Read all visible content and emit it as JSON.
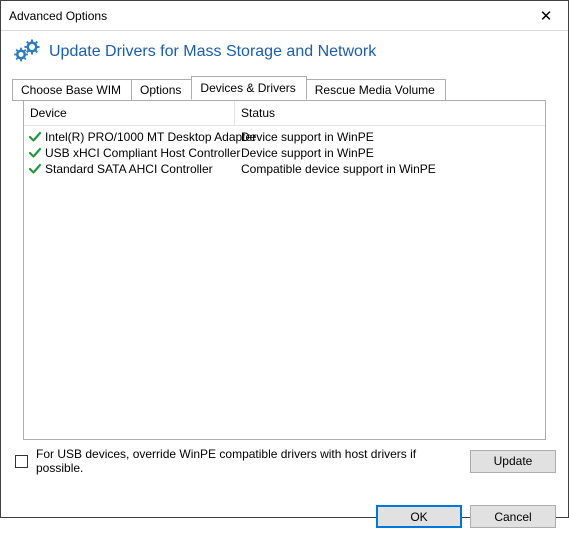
{
  "window": {
    "title": "Advanced Options",
    "close_glyph": "✕"
  },
  "header": {
    "title": "Update Drivers for Mass Storage and Network"
  },
  "tabs": {
    "items": [
      {
        "label": "Choose Base WIM"
      },
      {
        "label": "Options"
      },
      {
        "label": "Devices & Drivers"
      },
      {
        "label": "Rescue Media Volume"
      }
    ],
    "active_index": 2
  },
  "table": {
    "columns": {
      "device": "Device",
      "status": "Status"
    },
    "rows": [
      {
        "device": "Intel(R) PRO/1000 MT Desktop Adapter",
        "status": "Device support in WinPE"
      },
      {
        "device": "USB xHCI Compliant Host Controller",
        "status": "Device support in WinPE"
      },
      {
        "device": "Standard SATA AHCI Controller",
        "status": "Compatible device support in WinPE"
      }
    ]
  },
  "checkbox": {
    "checked": false,
    "label": "For USB devices, override WinPE compatible drivers with host drivers if possible."
  },
  "buttons": {
    "update": "Update",
    "ok": "OK",
    "cancel": "Cancel"
  }
}
